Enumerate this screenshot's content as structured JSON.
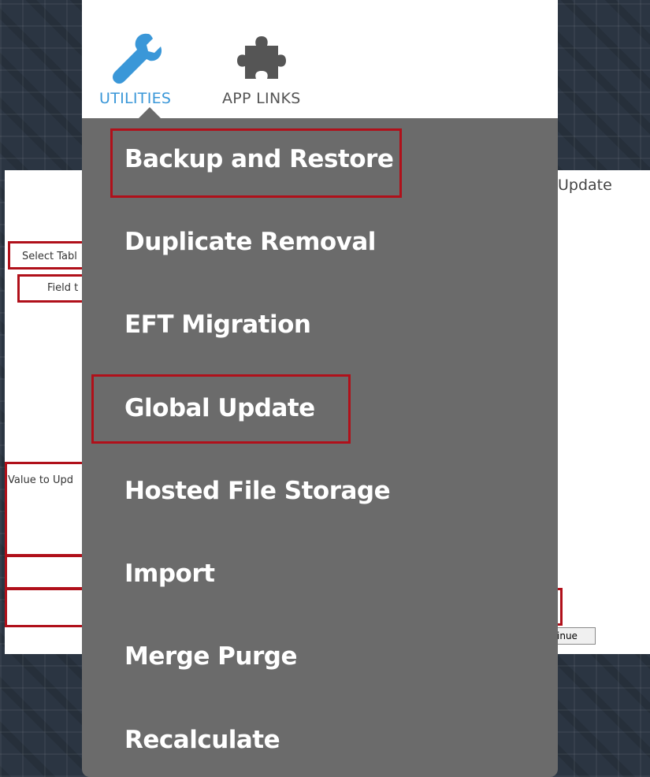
{
  "background_page": {
    "title_fragment": "Update",
    "select_table_label": "Select Tabl",
    "field_label": "Field t",
    "value_label": "Value to Upd",
    "continue_button": "inue"
  },
  "nav": {
    "utilities_label": "UTILITIES",
    "app_links_label": "APP LINKS",
    "utilities_icon": "wrench-icon",
    "app_links_icon": "puzzle-icon",
    "accent_color": "#3a97d8"
  },
  "menu": {
    "items": [
      "Backup and Restore",
      "Duplicate Removal",
      "EFT Migration",
      "Global Update",
      "Hosted File Storage",
      "Import",
      "Merge Purge",
      "Recalculate"
    ],
    "highlighted": [
      "Backup and Restore",
      "Global Update"
    ],
    "highlight_color": "#b0101a"
  }
}
